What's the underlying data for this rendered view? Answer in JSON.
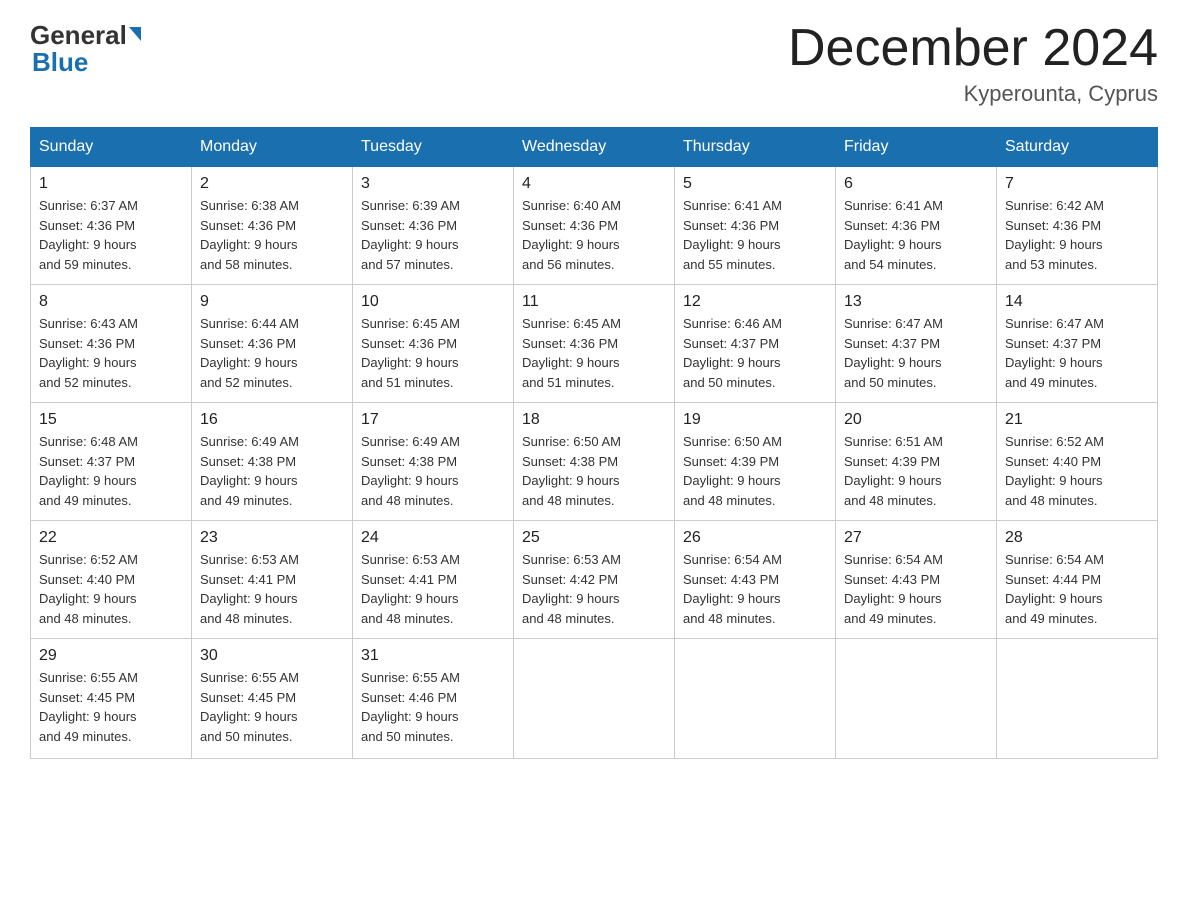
{
  "header": {
    "logo_general": "General",
    "logo_blue": "Blue",
    "month_title": "December 2024",
    "location": "Kyperounta, Cyprus"
  },
  "days_of_week": [
    "Sunday",
    "Monday",
    "Tuesday",
    "Wednesday",
    "Thursday",
    "Friday",
    "Saturday"
  ],
  "weeks": [
    [
      {
        "day": "1",
        "sunrise": "6:37 AM",
        "sunset": "4:36 PM",
        "daylight": "9 hours and 59 minutes."
      },
      {
        "day": "2",
        "sunrise": "6:38 AM",
        "sunset": "4:36 PM",
        "daylight": "9 hours and 58 minutes."
      },
      {
        "day": "3",
        "sunrise": "6:39 AM",
        "sunset": "4:36 PM",
        "daylight": "9 hours and 57 minutes."
      },
      {
        "day": "4",
        "sunrise": "6:40 AM",
        "sunset": "4:36 PM",
        "daylight": "9 hours and 56 minutes."
      },
      {
        "day": "5",
        "sunrise": "6:41 AM",
        "sunset": "4:36 PM",
        "daylight": "9 hours and 55 minutes."
      },
      {
        "day": "6",
        "sunrise": "6:41 AM",
        "sunset": "4:36 PM",
        "daylight": "9 hours and 54 minutes."
      },
      {
        "day": "7",
        "sunrise": "6:42 AM",
        "sunset": "4:36 PM",
        "daylight": "9 hours and 53 minutes."
      }
    ],
    [
      {
        "day": "8",
        "sunrise": "6:43 AM",
        "sunset": "4:36 PM",
        "daylight": "9 hours and 52 minutes."
      },
      {
        "day": "9",
        "sunrise": "6:44 AM",
        "sunset": "4:36 PM",
        "daylight": "9 hours and 52 minutes."
      },
      {
        "day": "10",
        "sunrise": "6:45 AM",
        "sunset": "4:36 PM",
        "daylight": "9 hours and 51 minutes."
      },
      {
        "day": "11",
        "sunrise": "6:45 AM",
        "sunset": "4:36 PM",
        "daylight": "9 hours and 51 minutes."
      },
      {
        "day": "12",
        "sunrise": "6:46 AM",
        "sunset": "4:37 PM",
        "daylight": "9 hours and 50 minutes."
      },
      {
        "day": "13",
        "sunrise": "6:47 AM",
        "sunset": "4:37 PM",
        "daylight": "9 hours and 50 minutes."
      },
      {
        "day": "14",
        "sunrise": "6:47 AM",
        "sunset": "4:37 PM",
        "daylight": "9 hours and 49 minutes."
      }
    ],
    [
      {
        "day": "15",
        "sunrise": "6:48 AM",
        "sunset": "4:37 PM",
        "daylight": "9 hours and 49 minutes."
      },
      {
        "day": "16",
        "sunrise": "6:49 AM",
        "sunset": "4:38 PM",
        "daylight": "9 hours and 49 minutes."
      },
      {
        "day": "17",
        "sunrise": "6:49 AM",
        "sunset": "4:38 PM",
        "daylight": "9 hours and 48 minutes."
      },
      {
        "day": "18",
        "sunrise": "6:50 AM",
        "sunset": "4:38 PM",
        "daylight": "9 hours and 48 minutes."
      },
      {
        "day": "19",
        "sunrise": "6:50 AM",
        "sunset": "4:39 PM",
        "daylight": "9 hours and 48 minutes."
      },
      {
        "day": "20",
        "sunrise": "6:51 AM",
        "sunset": "4:39 PM",
        "daylight": "9 hours and 48 minutes."
      },
      {
        "day": "21",
        "sunrise": "6:52 AM",
        "sunset": "4:40 PM",
        "daylight": "9 hours and 48 minutes."
      }
    ],
    [
      {
        "day": "22",
        "sunrise": "6:52 AM",
        "sunset": "4:40 PM",
        "daylight": "9 hours and 48 minutes."
      },
      {
        "day": "23",
        "sunrise": "6:53 AM",
        "sunset": "4:41 PM",
        "daylight": "9 hours and 48 minutes."
      },
      {
        "day": "24",
        "sunrise": "6:53 AM",
        "sunset": "4:41 PM",
        "daylight": "9 hours and 48 minutes."
      },
      {
        "day": "25",
        "sunrise": "6:53 AM",
        "sunset": "4:42 PM",
        "daylight": "9 hours and 48 minutes."
      },
      {
        "day": "26",
        "sunrise": "6:54 AM",
        "sunset": "4:43 PM",
        "daylight": "9 hours and 48 minutes."
      },
      {
        "day": "27",
        "sunrise": "6:54 AM",
        "sunset": "4:43 PM",
        "daylight": "9 hours and 49 minutes."
      },
      {
        "day": "28",
        "sunrise": "6:54 AM",
        "sunset": "4:44 PM",
        "daylight": "9 hours and 49 minutes."
      }
    ],
    [
      {
        "day": "29",
        "sunrise": "6:55 AM",
        "sunset": "4:45 PM",
        "daylight": "9 hours and 49 minutes."
      },
      {
        "day": "30",
        "sunrise": "6:55 AM",
        "sunset": "4:45 PM",
        "daylight": "9 hours and 50 minutes."
      },
      {
        "day": "31",
        "sunrise": "6:55 AM",
        "sunset": "4:46 PM",
        "daylight": "9 hours and 50 minutes."
      },
      null,
      null,
      null,
      null
    ]
  ]
}
